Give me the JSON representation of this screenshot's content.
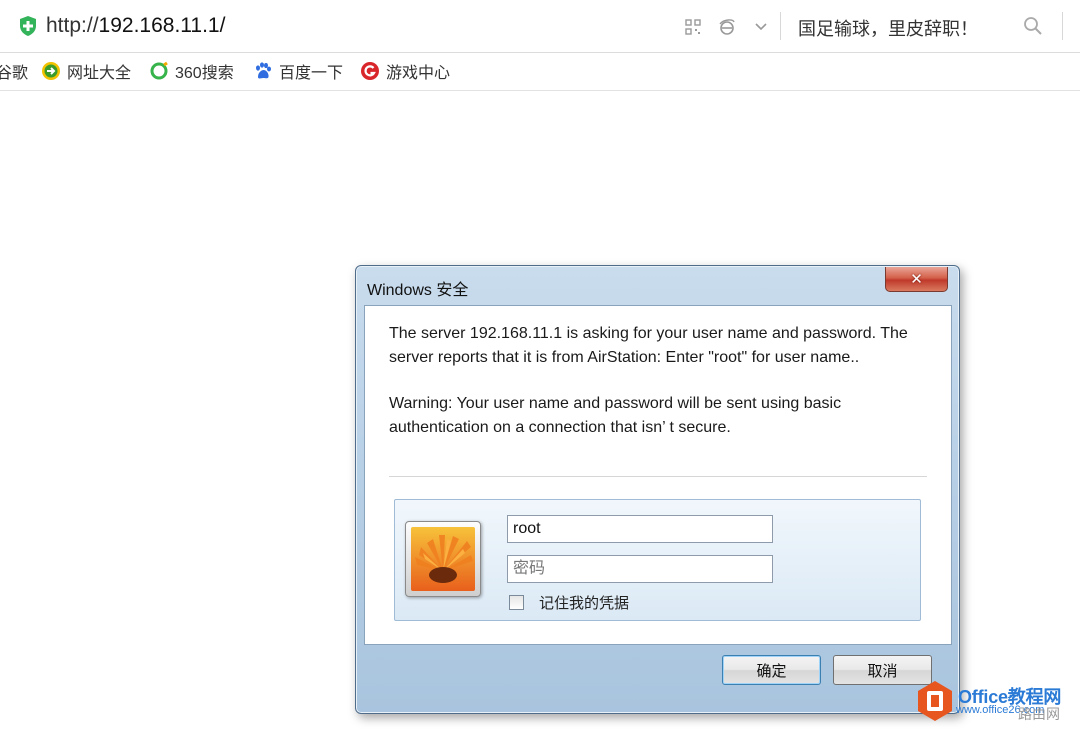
{
  "browser": {
    "url_prefix": "http://",
    "url_host": "192.168.11.1/",
    "search_text": "国足输球，里皮辞职！",
    "bookmarks": [
      {
        "label": "谷歌",
        "icon": "google-icon"
      },
      {
        "label": "网址大全",
        "icon": "green-arrow-icon"
      },
      {
        "label": "360搜索",
        "icon": "360-search-icon"
      },
      {
        "label": "百度一下",
        "icon": "baidu-paw-icon"
      },
      {
        "label": "游戏中心",
        "icon": "game-center-icon"
      }
    ]
  },
  "dialog": {
    "title": "Windows 安全",
    "close_symbol": "✕",
    "message_1": "The server 192.168.11.1 is asking for your user name and password. The server reports that it is from AirStation: Enter \"root\" for user name..",
    "message_2": "Warning: Your user name and password will be sent using basic authentication on a connection that isn’ t secure.",
    "username_value": "root",
    "password_placeholder": "密码",
    "remember_label": "记住我的凭据",
    "ok_label": "确定",
    "cancel_label": "取消"
  },
  "watermark": {
    "brand": "Office教程网",
    "url": "www.office26.com",
    "side_text": "路由网"
  },
  "colors": {
    "secure_green": "#33b35a",
    "dialog_frame": "#b8d0e6",
    "close_red": "#c0392b",
    "brand_orange": "#e8561f",
    "brand_blue": "#2b7bd6"
  }
}
